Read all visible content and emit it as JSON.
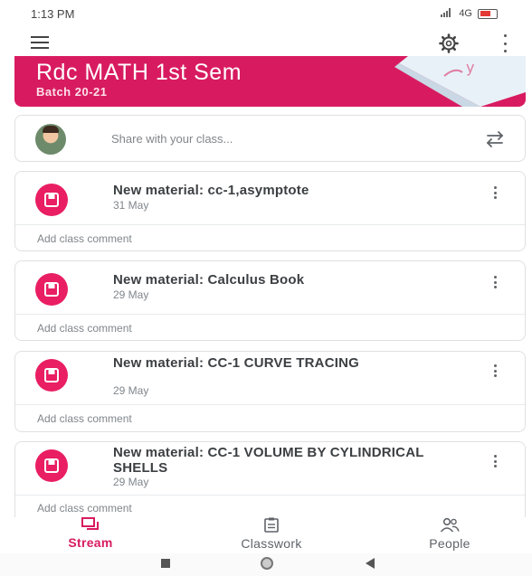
{
  "status_bar": {
    "time": "1:13 PM",
    "network": "4G"
  },
  "banner": {
    "title": "Rdc  MATH  1st Sem",
    "subtitle": "Batch 20-21"
  },
  "share": {
    "placeholder": "Share with your class..."
  },
  "posts": [
    {
      "title": "New material: cc-1,asymptote",
      "date": "31 May",
      "comment": "Add class comment"
    },
    {
      "title": "New material: Calculus Book",
      "date": "29 May",
      "comment": "Add class comment"
    },
    {
      "title": "New material: CC-1 CURVE TRACING",
      "date": "29 May",
      "comment": "Add class comment"
    },
    {
      "title": "New material: CC-1 VOLUME BY CYLINDRICAL SHELLS",
      "date": "29 May",
      "comment": "Add class comment"
    }
  ],
  "bottom_nav": {
    "stream": "Stream",
    "classwork": "Classwork",
    "people": "People"
  },
  "colors": {
    "accent": "#d81b60",
    "post_icon": "#e91e63"
  }
}
